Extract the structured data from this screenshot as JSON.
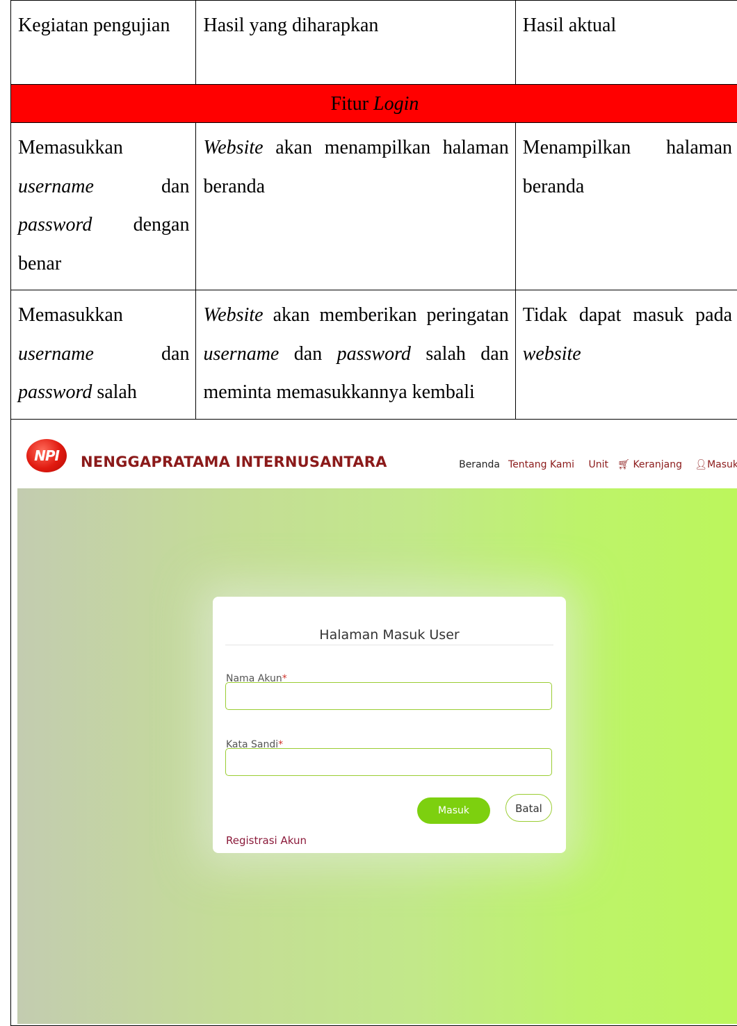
{
  "table": {
    "header": {
      "col1": "Kegiatan pengujian",
      "col2": "Hasil yang diharapkan",
      "col3": "Hasil aktual"
    },
    "section": {
      "prefix": "Fitur ",
      "italic": "Login"
    },
    "rows": [
      {
        "c1": [
          "Memasukkan ",
          {
            "i": "username"
          },
          " dan ",
          {
            "i": "password"
          },
          " dengan benar"
        ],
        "c2": [
          {
            "i": "Website"
          },
          " akan menampilkan halaman beranda"
        ],
        "c3": [
          "Menampilkan halaman beranda"
        ]
      },
      {
        "c1": [
          "Memasukkan ",
          {
            "i": "username"
          },
          " dan ",
          {
            "i": "password"
          },
          " salah"
        ],
        "c2": [
          {
            "i": "Website"
          },
          " akan memberikan peringatan ",
          {
            "i": "username"
          },
          " dan ",
          {
            "i": "password"
          },
          " salah dan meminta memasukkannya kembali"
        ],
        "c3": [
          "Tidak dapat masuk pada ",
          {
            "i": "website"
          }
        ]
      }
    ]
  },
  "screenshot": {
    "logo_text": "NPI",
    "brand": "NENGGAPRATAMA INTERNUSANTARA",
    "nav": {
      "beranda": "Beranda",
      "tentang": "Tentang Kami",
      "unit": "Unit",
      "keranjang": "Keranjang",
      "masuk": "Masuk"
    },
    "card": {
      "title": "Halaman Masuk User",
      "username_label": "Nama Akun",
      "password_label": "Kata Sandi",
      "required_mark": "*",
      "submit": "Masuk",
      "cancel": "Batal",
      "register": "Registrasi Akun"
    }
  }
}
